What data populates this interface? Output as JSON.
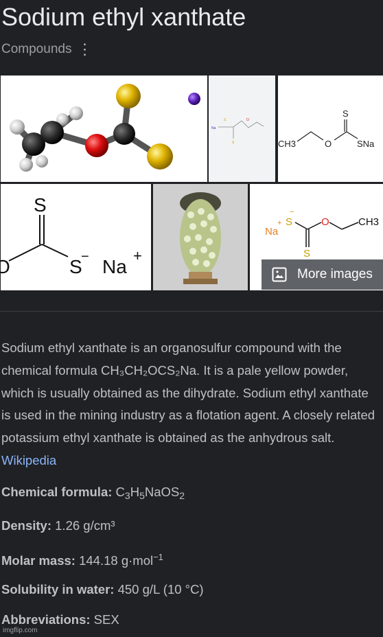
{
  "header": {
    "title": "Sodium ethyl xanthate",
    "category": "Compounds"
  },
  "images": {
    "tile3": {
      "ch3": "CH3",
      "o": "O",
      "s": "S",
      "sna": "SNa"
    },
    "tile4": {
      "s": "S",
      "o": "O",
      "s2": "S",
      "na": "Na"
    },
    "tile6": {
      "na": "Na",
      "s_top": "S",
      "o": "O",
      "ch3": "CH3",
      "s_bottom": "S"
    },
    "more_images_label": "More images"
  },
  "description": {
    "text": "Sodium ethyl xanthate is an organosulfur compound with the chemical formula CH₃CH₂OCS₂Na. It is a pale yellow powder, which is usually obtained as the dihydrate. Sodium ethyl xanthate is used in the mining industry as a flotation agent. A closely related potassium ethyl xanthate is obtained as the anhydrous salt.",
    "source_link": "Wikipedia"
  },
  "facts": {
    "formula_label": "Chemical formula:",
    "formula_parts": [
      "C",
      "3",
      "H",
      "5",
      "NaOS",
      "2"
    ],
    "density_label": "Density:",
    "density_value": "1.26 g/cm³",
    "molar_label": "Molar mass:",
    "molar_value": "144.18 g·mol",
    "molar_exp": "−1",
    "solubility_label": "Solubility in water:",
    "solubility_value": "450 g/L (10 °C)",
    "abbrev_label": "Abbreviations:",
    "abbrev_value": "SEX"
  },
  "watermark": "imgflip.com",
  "colors": {
    "background": "#202124",
    "title": "#e8eaed",
    "text": "#bdc1c6",
    "link": "#8ab4f8",
    "sulfur": "#e6b800",
    "oxygen": "#e02020",
    "sodium": "#6a2bc9"
  }
}
